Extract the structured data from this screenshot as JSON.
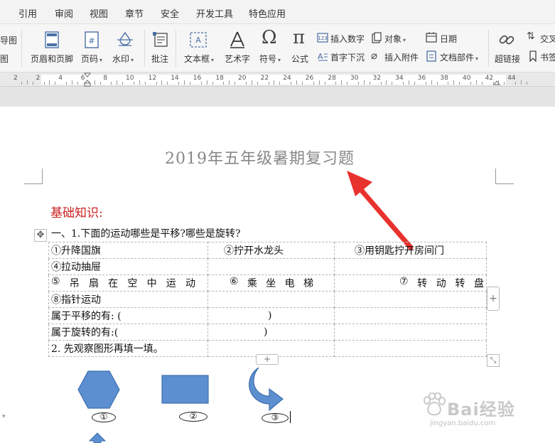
{
  "menu": {
    "items": [
      "引用",
      "审阅",
      "视图",
      "章节",
      "安全",
      "开发工具",
      "特色应用"
    ]
  },
  "ribbon": {
    "partial_left_top": "导图",
    "partial_left_bottom": "图",
    "header_footer": "页眉和页脚",
    "page_number": "页码",
    "watermark": "水印",
    "comment": "批注",
    "text_box": "文本框",
    "word_art": "艺术字",
    "symbol": "符号",
    "formula": "公式",
    "insert_number": "插入数字",
    "first_sink": "首字下沉",
    "object": "对象",
    "insert_attachment": "插入附件",
    "date": "日期",
    "doc_parts": "文档部件",
    "hyperlink": "超链接",
    "cross_ref_partial": "交叉",
    "bookmark_partial": "书签"
  },
  "ruler": {
    "labels": [
      "2",
      "2",
      "4",
      "6",
      "8",
      "10",
      "12",
      "14",
      "16",
      "18",
      "20",
      "22",
      "24",
      "26",
      "28",
      "30",
      "32",
      "34",
      "36",
      "38",
      "40",
      "42",
      "44"
    ]
  },
  "document": {
    "title": "2019年五年级暑期复习题",
    "section_heading": "基础知识:",
    "question1": "一、1.下面的运动哪些是平移?哪些是旋转?",
    "table": {
      "r1c1": "①升降国旗",
      "r1c2": "②拧开水龙头",
      "r1c3": "③用钥匙拧开房间门",
      "r2c1": "④拉动抽屉",
      "r3c1_parts": [
        "⑤",
        "吊",
        "扇",
        "在",
        "空",
        "中",
        "运",
        "动"
      ],
      "r3c2_parts": [
        "⑥",
        "乘",
        "坐",
        "电",
        "梯"
      ],
      "r3c3_parts": [
        "⑦",
        "转",
        "动",
        "转",
        "盘"
      ],
      "r4c1": "⑧指针运动",
      "r5c1": "属于平移的有: (",
      "r5c2": ")",
      "r6c1": "属于旋转的有:(",
      "r6c2": ")",
      "r7c1": "2. 先观察图形再填一填。"
    },
    "shape_labels": [
      "①",
      "②",
      "③"
    ],
    "add_symbol": "+"
  },
  "watermark": {
    "main": "Bai经验",
    "sub": "jingyan.baidu.com"
  },
  "colors": {
    "shape_fill": "#5b8fd0",
    "shape_stroke": "#3f6fae",
    "heading_red": "#cc2222",
    "arrow_red": "#e8322e"
  }
}
